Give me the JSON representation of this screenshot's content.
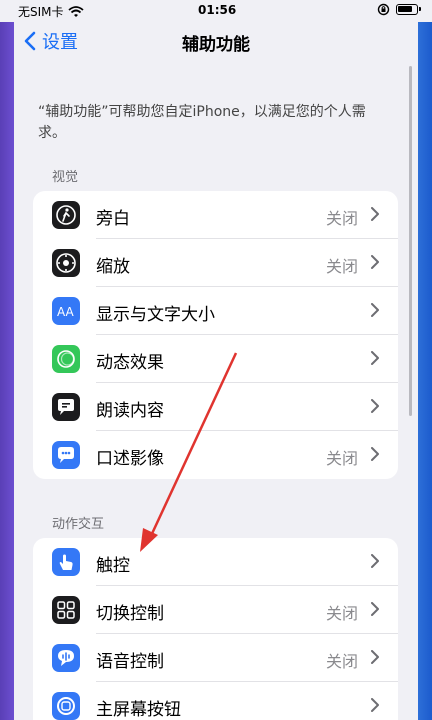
{
  "status": {
    "carrier": "无SIM卡",
    "time": "01:56",
    "battery_level": 0.8
  },
  "nav": {
    "back_label": "设置",
    "title": "辅助功能"
  },
  "intro": "“辅助功能”可帮助您自定iPhone，以满足您的个人需求。",
  "sections": [
    {
      "label": "视觉",
      "items": [
        {
          "label": "旁白",
          "value": "关闭",
          "icon": "voiceover-icon",
          "color": "#1c1c1e"
        },
        {
          "label": "缩放",
          "value": "关闭",
          "icon": "zoom-icon",
          "color": "#1c1c1e"
        },
        {
          "label": "显示与文字大小",
          "value": "",
          "icon": "text-size-icon",
          "color": "#3478f6"
        },
        {
          "label": "动态效果",
          "value": "",
          "icon": "motion-icon",
          "color": "#34c759"
        },
        {
          "label": "朗读内容",
          "value": "",
          "icon": "spoken-content-icon",
          "color": "#1c1c1e"
        },
        {
          "label": "口述影像",
          "value": "关闭",
          "icon": "audio-description-icon",
          "color": "#3478f6"
        }
      ]
    },
    {
      "label": "动作交互",
      "items": [
        {
          "label": "触控",
          "value": "",
          "icon": "touch-icon",
          "color": "#3478f6"
        },
        {
          "label": "切换控制",
          "value": "关闭",
          "icon": "switch-control-icon",
          "color": "#1c1c1e"
        },
        {
          "label": "语音控制",
          "value": "关闭",
          "icon": "voice-control-icon",
          "color": "#3478f6"
        },
        {
          "label": "主屏幕按钮",
          "value": "",
          "icon": "home-button-icon",
          "color": "#3478f6"
        }
      ]
    }
  ],
  "colors": {
    "accent": "#1a6ef5",
    "annotation_arrow": "#e0342f"
  }
}
